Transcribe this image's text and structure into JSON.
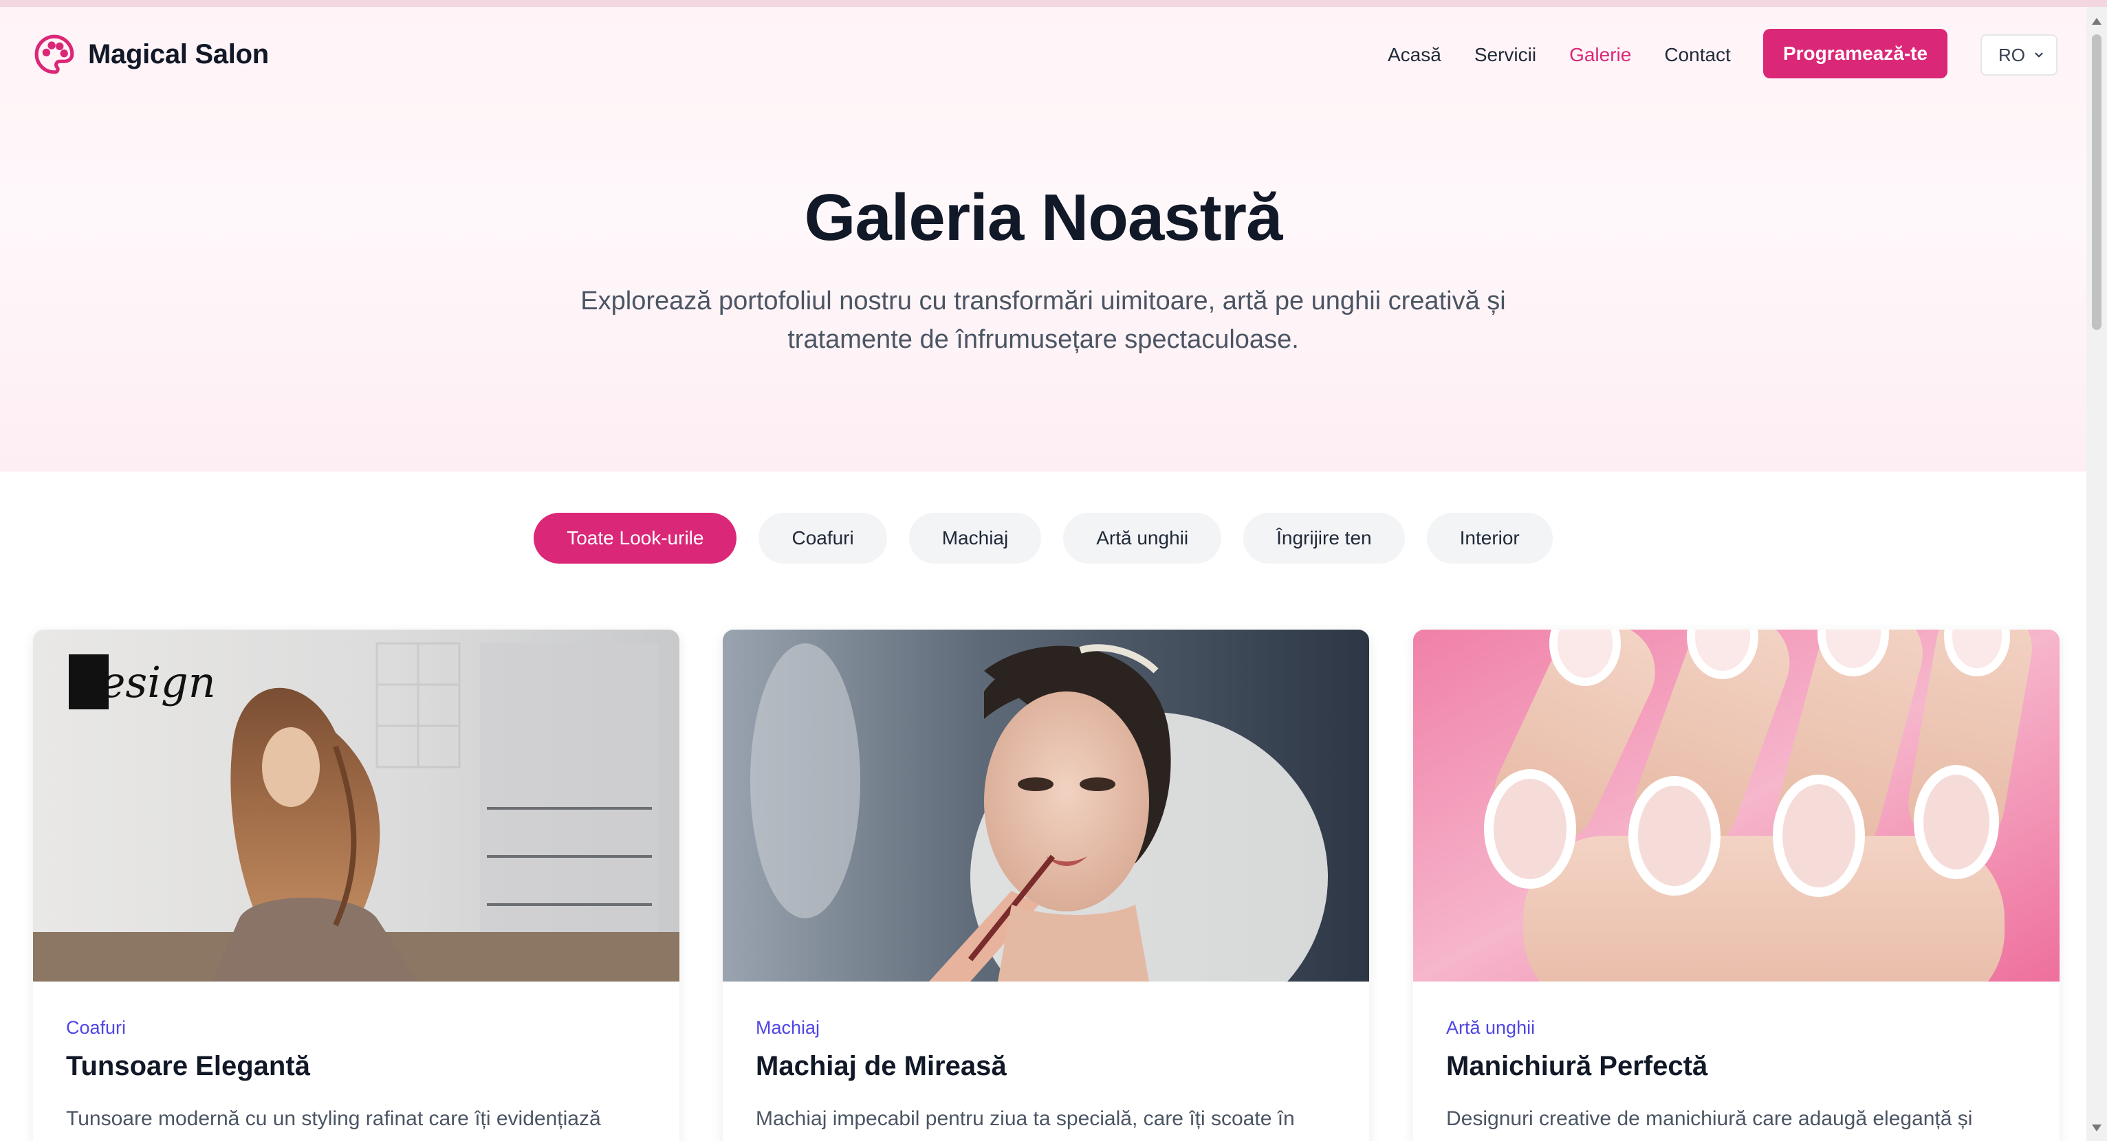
{
  "brand": {
    "name": "Magical Salon",
    "icon": "palette-icon",
    "accent": "#db2777"
  },
  "nav": {
    "items": [
      {
        "label": "Acasă"
      },
      {
        "label": "Servicii"
      },
      {
        "label": "Galerie",
        "active": true
      },
      {
        "label": "Contact"
      }
    ],
    "cta_label": "Programează-te",
    "language": "RO"
  },
  "hero": {
    "title": "Galeria Noastră",
    "subtitle_line1": "Explorează portofoliul nostru cu transformări uimitoare, artă pe unghii creativă și",
    "subtitle_line2": "tratamente de înfrumusețare spectaculoase."
  },
  "filters": [
    {
      "label": "Toate Look-urile",
      "active": true
    },
    {
      "label": "Coafuri"
    },
    {
      "label": "Machiaj"
    },
    {
      "label": "Artă unghii"
    },
    {
      "label": "Îngrijire ten"
    },
    {
      "label": "Interior"
    }
  ],
  "cards": [
    {
      "category": "Coafuri",
      "title": "Tunsoare Elegantă",
      "description": "Tunsoare modernă cu un styling rafinat care îți evidențiază",
      "image_logo_text": "design"
    },
    {
      "category": "Machiaj",
      "title": "Machiaj de Mireasă",
      "description": "Machiaj impecabil pentru ziua ta specială, care îți scoate în"
    },
    {
      "category": "Artă unghii",
      "title": "Manichiură Perfectă",
      "description": "Designuri creative de manichiură care adaugă eleganță și"
    }
  ]
}
